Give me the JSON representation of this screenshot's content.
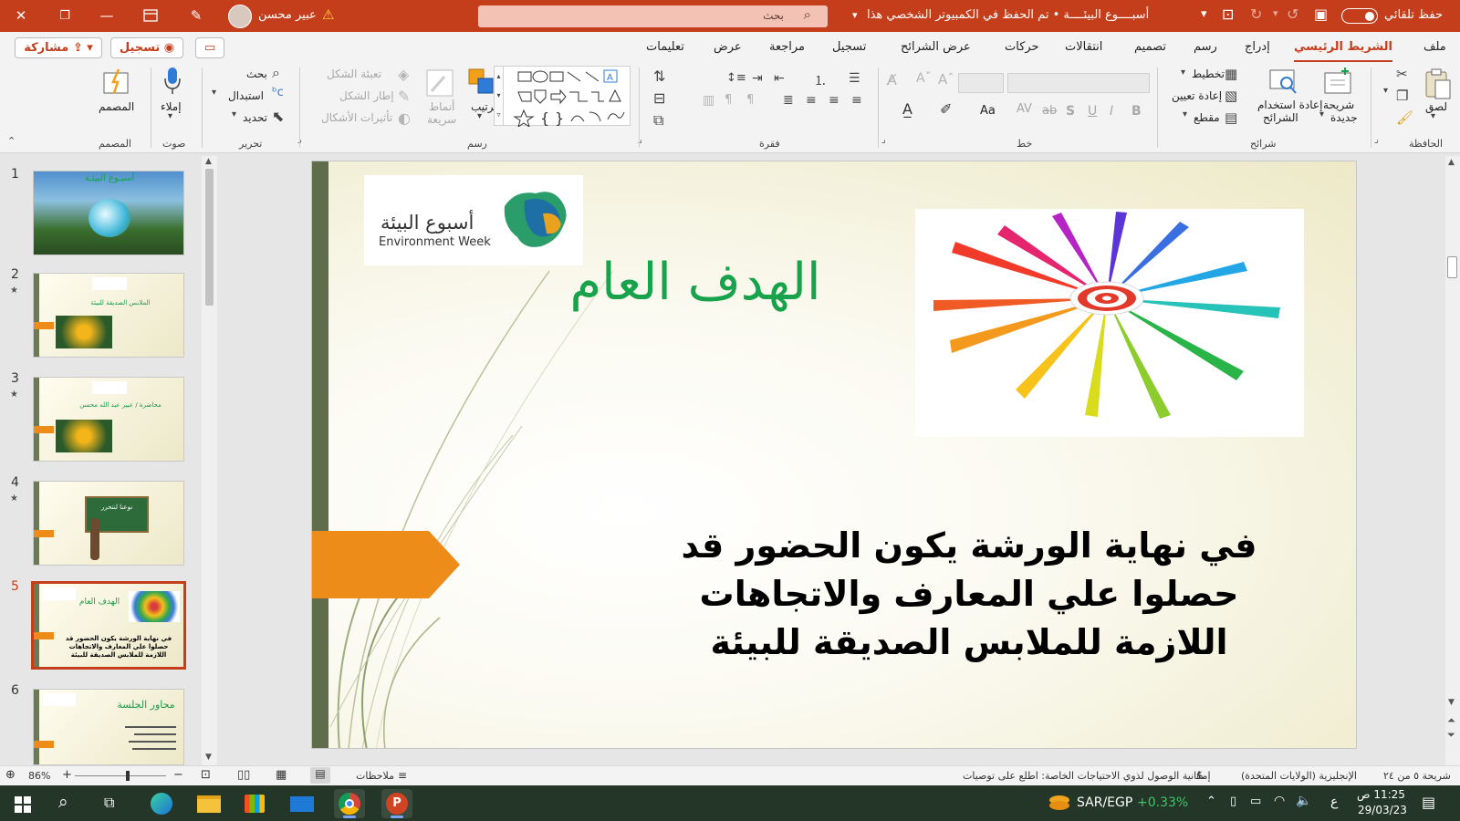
{
  "titlebar": {
    "autosave_label": "حفظ تلقائي",
    "doc_title": "أسبــــوع البيئــــة • تم الحفظ في الكمبيوتر الشخصي هذا",
    "search_placeholder": "بحث",
    "user_name": "عبير محسن",
    "bg_color": "#c43e1c"
  },
  "tabs": {
    "items": [
      "ملف",
      "الشريط الرئيسي",
      "إدراج",
      "رسم",
      "تصميم",
      "انتقالات",
      "حركات",
      "عرض الشرائح",
      "تسجيل",
      "مراجعة",
      "عرض",
      "تعليمات"
    ],
    "active": "الشريط الرئيسي",
    "record_label": "تسجيل",
    "share_label": "مشاركة"
  },
  "ribbon": {
    "groups": {
      "clipboard": "الحافظة",
      "slides": "شرائح",
      "font": "خط",
      "paragraph": "فقرة",
      "drawing": "رسم",
      "editing": "تحرير",
      "voice": "صوت",
      "designer": "المصمم"
    },
    "paste": "لصق",
    "new_slide_1": "شريحة",
    "new_slide_2": "جديدة",
    "reuse_slides_1": "إعادة استخدام",
    "reuse_slides_2": "الشرائح",
    "layout": "تخطيط",
    "reset": "إعادة تعيين",
    "section": "مقطع",
    "arrange": "ترتيب",
    "quick_styles_1": "أنماط",
    "quick_styles_2": "سريعة",
    "shape_fill": "تعبئة الشكل",
    "shape_outline": "إطار الشكل",
    "shape_effects": "تأثيرات الأشكال",
    "find": "بحث",
    "replace": "استبدال",
    "select": "تحديد",
    "dictate": "إملاء",
    "designer": "المصمم",
    "font_buttons": [
      "B",
      "I",
      "U",
      "S",
      "ab",
      "AV",
      "Aa"
    ]
  },
  "thumbnails": [
    {
      "num": "1",
      "star": false,
      "title": "أسبـوع البيئـة"
    },
    {
      "num": "2",
      "star": true,
      "title": "الملابس الصديقة للبيئة"
    },
    {
      "num": "3",
      "star": true,
      "title": "محاضرة / عبير عبد الله محسن"
    },
    {
      "num": "4",
      "star": true,
      "title": "نوعنا لنتحرر"
    },
    {
      "num": "5",
      "star": false,
      "title": "الهدف العام",
      "body": "في نهاية الورشة يكون الحضور قد حصلوا علي المعارف والاتجاهات اللازمة للملابس الصديقة للبيئة"
    },
    {
      "num": "6",
      "star": false,
      "title": "محاور الجلسة"
    }
  ],
  "selected_slide": "5",
  "slide": {
    "logo_ar": "أسبوع البيئة",
    "logo_en": "Environment Week",
    "title": "الهدف العام",
    "body": "في نهاية الورشة يكون الحضور قد حصلوا علي المعارف والاتجاهات اللازمة للملابس الصديقة للبيئة",
    "title_color": "#17a24b",
    "accent_color": "#ee8c1a"
  },
  "status": {
    "slide_of": "شريحة ٥ من ٢٤",
    "language": "الإنجليزية (الولايات المتحدة)",
    "accessibility": "إمكانية الوصول لذوي الاحتياجات الخاصة: اطلع على توصيات",
    "notes": "ملاحظات",
    "zoom": "86%"
  },
  "taskbar": {
    "ticker": "SAR/EGP",
    "ticker_change": "+0.33%",
    "lang_indicator": "ع",
    "time": "11:25 ص",
    "date": "29/03/23"
  }
}
